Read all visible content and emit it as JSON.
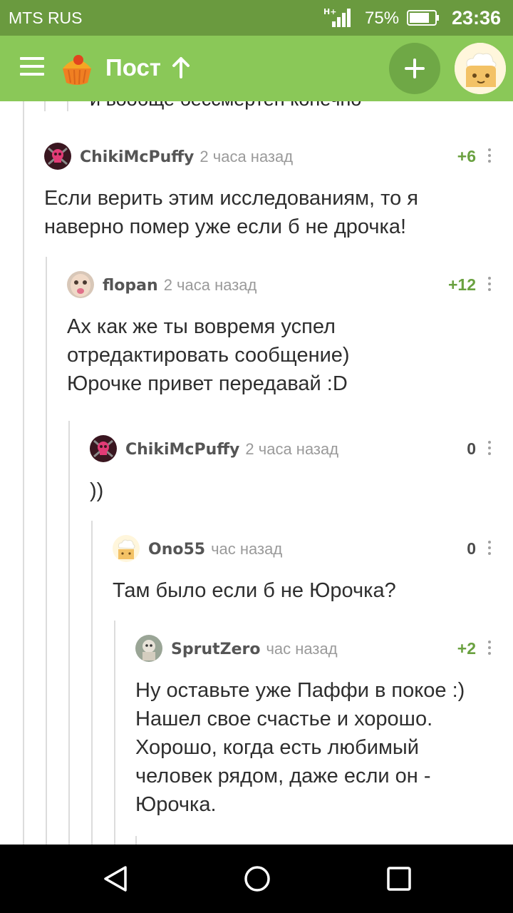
{
  "status_bar": {
    "carrier": "MTS RUS",
    "network": "H+",
    "battery": "75%",
    "time": "23:36",
    "icons": [
      "signal-icon",
      "battery-icon"
    ]
  },
  "app_bar": {
    "title": "Пост",
    "icons": [
      "menu-icon",
      "cupcake-logo-icon",
      "arrow-up-icon",
      "plus-icon",
      "profile-avatar"
    ]
  },
  "clipped_previous_comment_text": "и вообще бессмертен конечно",
  "comments": [
    {
      "user": "ChikiMcPuffy",
      "time": "2 часа назад",
      "rating": "+6",
      "body": [
        "Если верить этим исследованиям, то я",
        "наверно помер уже если б не дрочка!"
      ]
    },
    {
      "user": "flopan",
      "time": "2 часа назад",
      "rating": "+12",
      "body": [
        "Ах как же ты вовремя успел",
        "отредактировать сообщение)",
        "Юрочке привет передавай :D"
      ]
    },
    {
      "user": "ChikiMcPuffy",
      "time": "2 часа назад",
      "rating": "0",
      "body": [
        "))"
      ]
    },
    {
      "user": "Ono55",
      "time": "час назад",
      "rating": "0",
      "body": [
        "Там было если б не Юрочка?"
      ]
    },
    {
      "user": "SprutZero",
      "time": "час назад",
      "rating": "+2",
      "body": [
        "Ну оставьте уже Паффи в покое :)",
        "Нашел свое счастье и хорошо.",
        "Хорошо, когда есть любимый",
        "человек рядом, даже если он -",
        "Юрочка."
      ]
    }
  ],
  "colors": {
    "status_bar": "#6a9a3f",
    "app_bar": "#8ac858",
    "positive_rating": "#6aa140",
    "thread_line": "#dcdcdc"
  }
}
